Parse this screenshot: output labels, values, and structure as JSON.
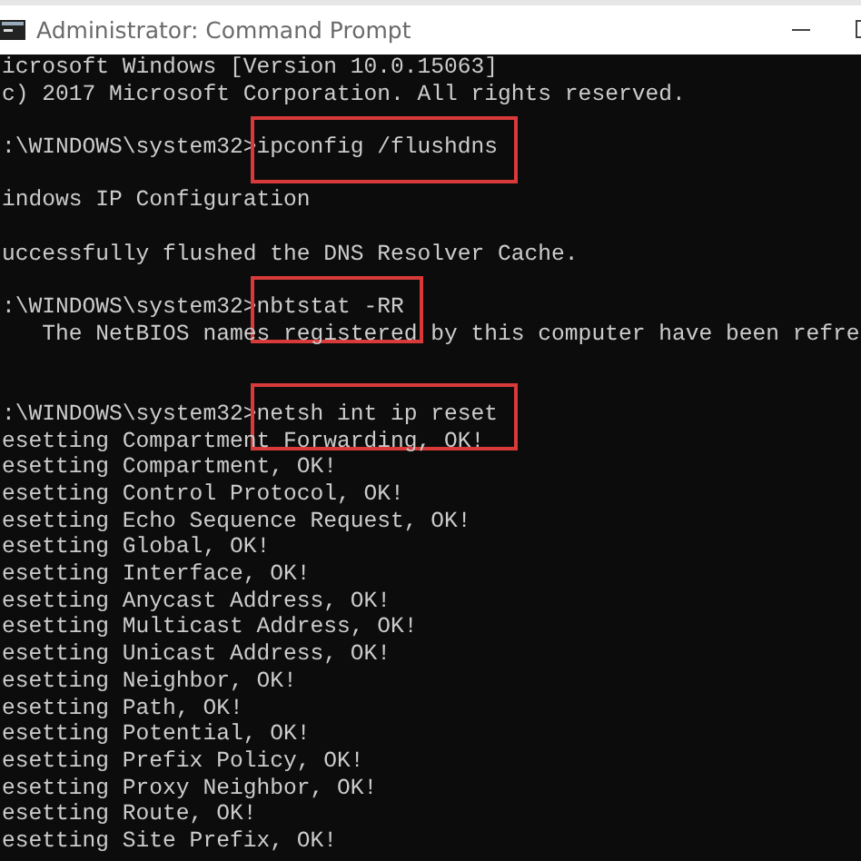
{
  "window": {
    "title": "Administrator: Command Prompt"
  },
  "lines": [
    {
      "kind": "output",
      "text": "icrosoft Windows [Version 10.0.15063]"
    },
    {
      "kind": "output",
      "text": "c) 2017 Microsoft Corporation. All rights reserved."
    },
    {
      "kind": "blank"
    },
    {
      "kind": "prompt",
      "prompt": ":\\WINDOWS\\system32>",
      "command": "ipconfig /flushdns",
      "highlighted": true
    },
    {
      "kind": "blank"
    },
    {
      "kind": "output",
      "text": "indows IP Configuration"
    },
    {
      "kind": "blank"
    },
    {
      "kind": "output",
      "text": "uccessfully flushed the DNS Resolver Cache."
    },
    {
      "kind": "blank"
    },
    {
      "kind": "prompt",
      "prompt": ":\\WINDOWS\\system32>",
      "command": "nbtstat -RR",
      "highlighted": true
    },
    {
      "kind": "output",
      "text": "   The NetBIOS names registered by this computer have been refre"
    },
    {
      "kind": "blank"
    },
    {
      "kind": "blank"
    },
    {
      "kind": "prompt",
      "prompt": ":\\WINDOWS\\system32>",
      "command": "netsh int ip reset",
      "highlighted": true
    },
    {
      "kind": "output",
      "text": "esetting Compartment Forwarding, OK!"
    },
    {
      "kind": "output",
      "text": "esetting Compartment, OK!"
    },
    {
      "kind": "output",
      "text": "esetting Control Protocol, OK!"
    },
    {
      "kind": "output",
      "text": "esetting Echo Sequence Request, OK!"
    },
    {
      "kind": "output",
      "text": "esetting Global, OK!"
    },
    {
      "kind": "output",
      "text": "esetting Interface, OK!"
    },
    {
      "kind": "output",
      "text": "esetting Anycast Address, OK!"
    },
    {
      "kind": "output",
      "text": "esetting Multicast Address, OK!"
    },
    {
      "kind": "output",
      "text": "esetting Unicast Address, OK!"
    },
    {
      "kind": "output",
      "text": "esetting Neighbor, OK!"
    },
    {
      "kind": "output",
      "text": "esetting Path, OK!"
    },
    {
      "kind": "output",
      "text": "esetting Potential, OK!"
    },
    {
      "kind": "output",
      "text": "esetting Prefix Policy, OK!"
    },
    {
      "kind": "output",
      "text": "esetting Proxy Neighbor, OK!"
    },
    {
      "kind": "output",
      "text": "esetting Route, OK!"
    },
    {
      "kind": "output",
      "text": "esetting Site Prefix, OK!"
    }
  ]
}
